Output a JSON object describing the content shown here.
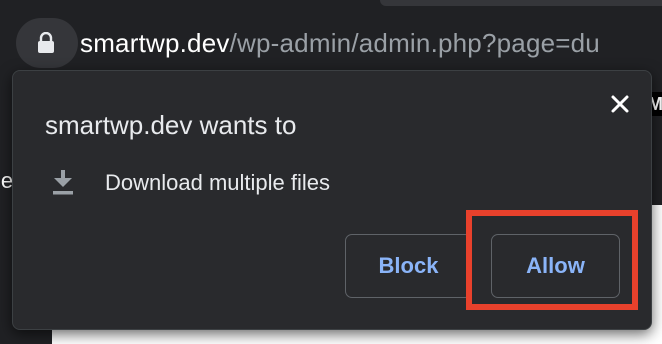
{
  "address_bar": {
    "host": "smartwp.dev",
    "path": "/wp-admin/admin.php?page=du",
    "lock_icon": "lock-icon"
  },
  "page_behind": {
    "left_fragment": "le",
    "right_fragment": "M"
  },
  "popup": {
    "title": "smartwp.dev wants to",
    "close_icon": "close-icon",
    "permission": {
      "icon": "download-icon",
      "label": "Download multiple files"
    },
    "buttons": {
      "block_label": "Block",
      "allow_label": "Allow"
    },
    "colors": {
      "background": "#292a2d",
      "text": "#e8eaed",
      "button_text": "#8ab4f8",
      "highlight": "#e8412c"
    }
  }
}
